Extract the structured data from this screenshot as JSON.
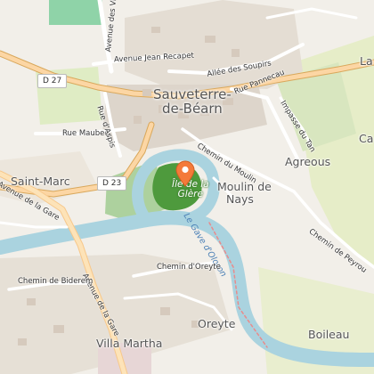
{
  "map": {
    "town": {
      "line1": "Sauveterre-",
      "line2": "de-Béarn"
    },
    "places": {
      "saint_marc": "Saint-Marc",
      "agreous": "Agreous",
      "moulin_line1": "Moulin de",
      "moulin_line2": "Nays",
      "oreyte": "Oreyte",
      "villa_martha": "Villa Martha",
      "boileau": "Boileau",
      "la_edge": "La",
      "ca_edge": "Ca"
    },
    "island": {
      "line1": "Île de la",
      "line2": "Glère"
    },
    "river": {
      "name": "Le Gave d'Oloron"
    },
    "routes": {
      "d27": "D 27",
      "d23": "D 23"
    },
    "streets": {
      "avenue_des_vignes": "Avenue des Vignes",
      "avenue_jean_recapet": "Avenue Jean Recapet",
      "allee_des_soupirs": "Allée des Soupirs",
      "rue_pannecau": "Rue Pannecau",
      "rue_maubec": "Rue Maubec",
      "rue_daspis": "Rue d'Aspis",
      "impasse_du_tan": "Impasse du Tan",
      "chemin_du_moulin": "Chemin du Moulin",
      "chemin_de_peyrou": "Chemin de Peyrou",
      "avenue_de_la_gare_top": "Avenue de la Gare",
      "avenue_de_la_gare_bottom": "Avenue de la Gare",
      "chemin_doreyte": "Chemin d'Oreyte",
      "chemin_de_biderem": "Chemin de Biderem"
    },
    "colors": {
      "background": "#f2efe9",
      "river": "#aad3df",
      "forest": "#add19e",
      "grass": "#cdebb0",
      "marker": "#f47a3a",
      "road_major": "#ffffff",
      "route_casing": "#d9a85c"
    },
    "marker_icon": "map-pin-icon"
  }
}
